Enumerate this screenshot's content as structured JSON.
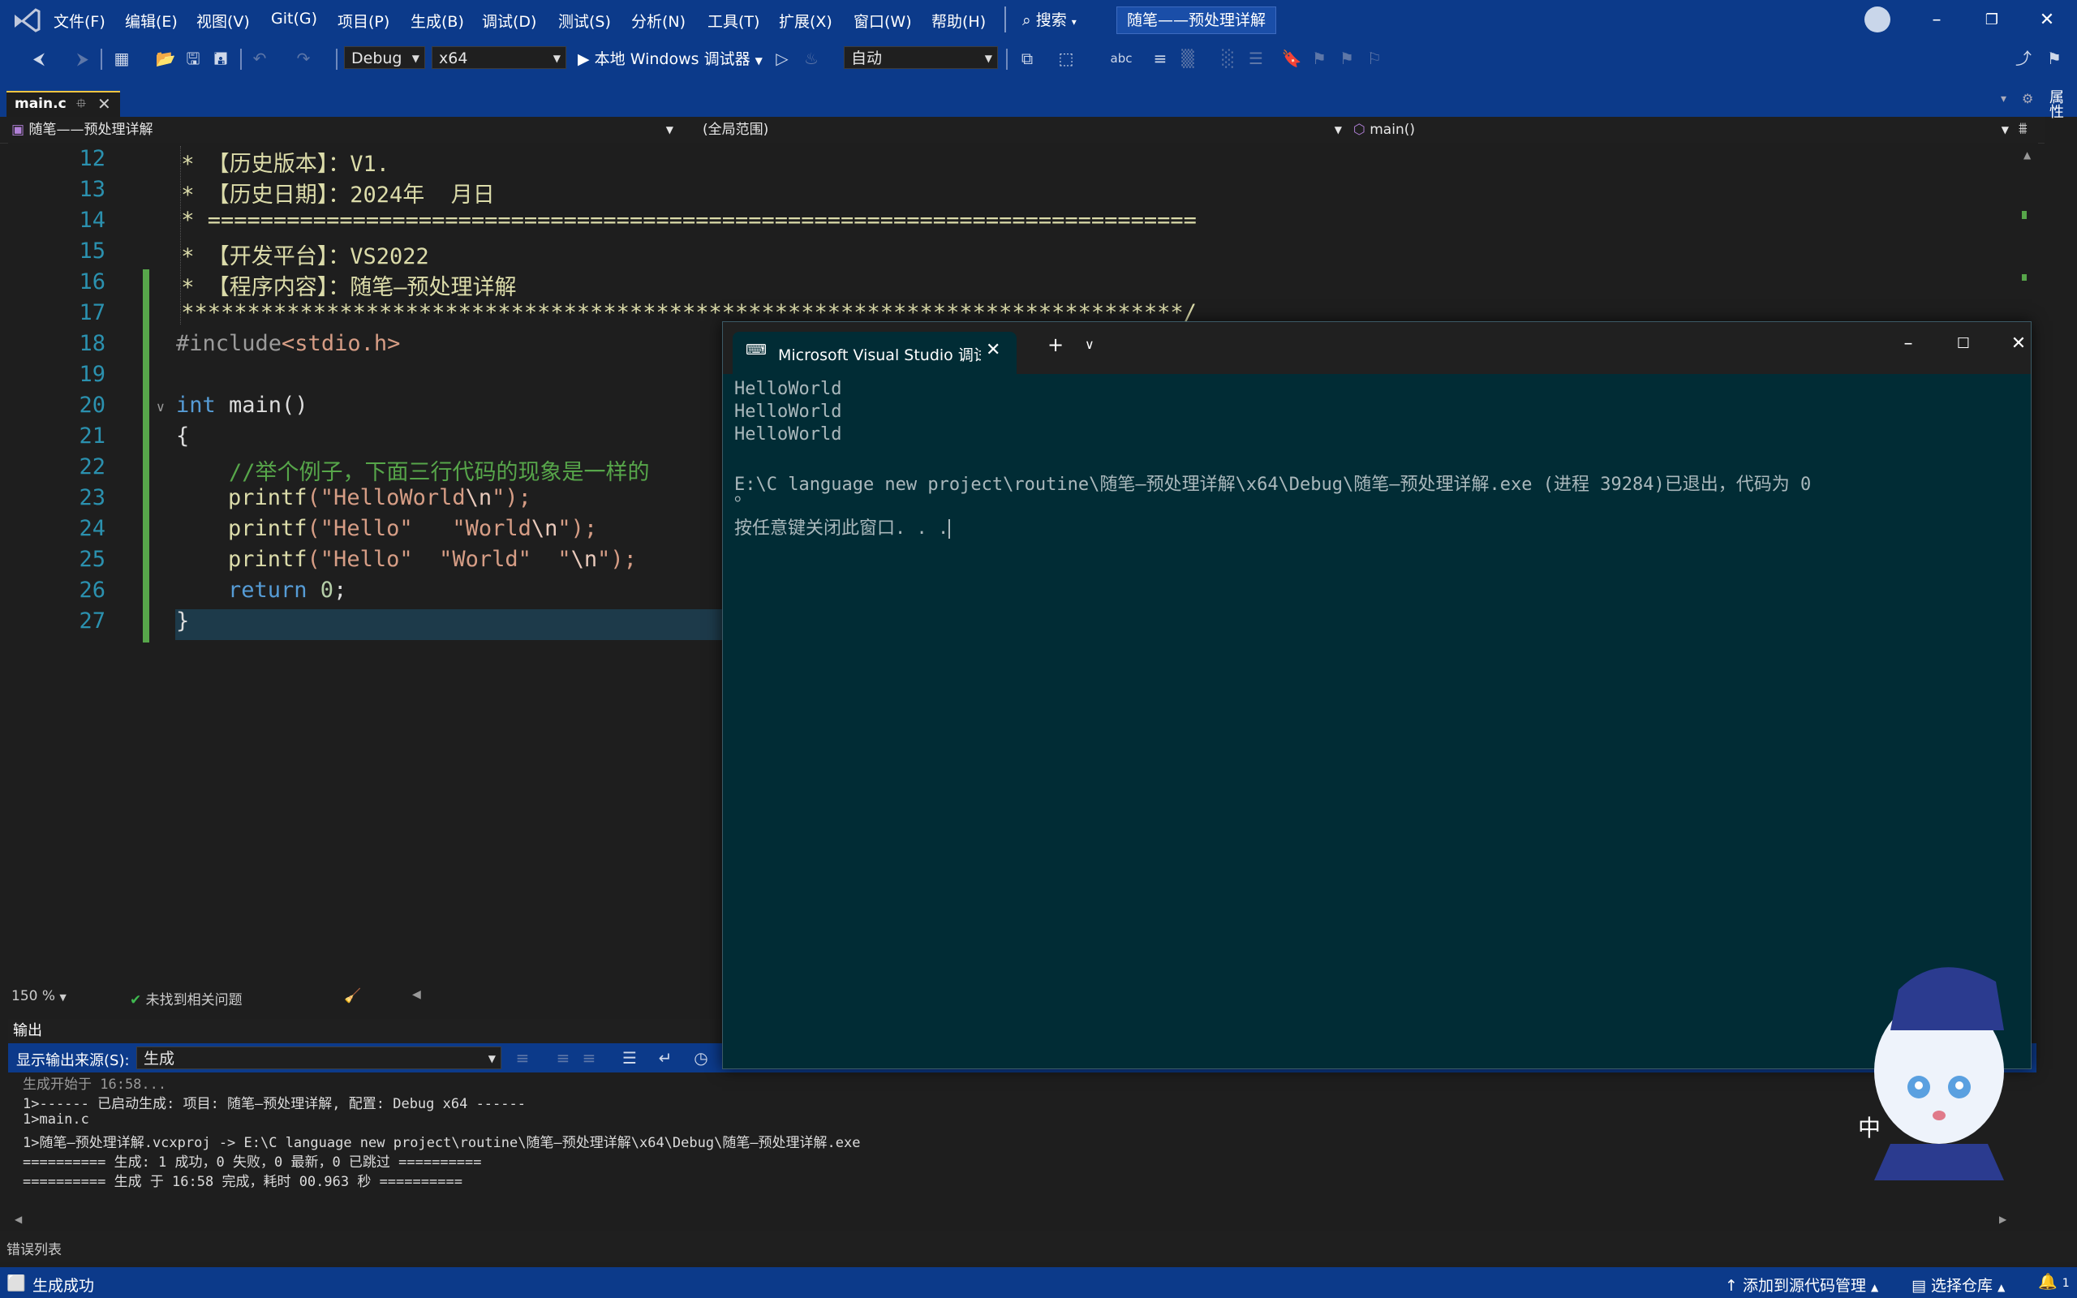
{
  "menubar": {
    "items": [
      "文件(F)",
      "编辑(E)",
      "视图(V)",
      "Git(G)",
      "项目(P)",
      "生成(B)",
      "调试(D)",
      "测试(S)",
      "分析(N)",
      "工具(T)",
      "扩展(X)",
      "窗口(W)",
      "帮助(H)"
    ],
    "search_label": "搜索",
    "solution_title": "随笔——预处理详解"
  },
  "toolbar": {
    "config": "Debug",
    "platform": "x64",
    "run_label": "本地 Windows 调试器",
    "auto_label": "自动"
  },
  "tabs": {
    "active": "main.c"
  },
  "right_panel_label": "属性",
  "navbar": {
    "project": "随笔——预处理详解",
    "scope": "(全局范围)",
    "member": "main()"
  },
  "editor": {
    "line_numbers": [
      "12",
      "13",
      "14",
      "15",
      "16",
      "17",
      "18",
      "19",
      "20",
      "21",
      "22",
      "23",
      "24",
      "25",
      "26",
      "27"
    ],
    "code": {
      "l12": " * 【历史版本】：V1.",
      "l13": " * 【历史日期】：2024年  月日",
      "l14": " * ===========================================================================",
      "l15": " * 【开发平台】：VS2022",
      "l16": " * 【程序内容】：随笔—预处理详解",
      "l17": " ****************************************************************************/",
      "l18_a": "#include",
      "l18_b": "<stdio.h>",
      "l20_kw": "int",
      "l20_rest": " main()",
      "l21": "{",
      "l22": "    //举个例子，下面三行代码的现象是一样的",
      "l23_fn": "printf",
      "l23_s1": "(\"HelloWorld",
      "l23_esc": "\\n",
      "l23_end": "\");",
      "l24_fn": "printf",
      "l24_s1": "(\"Hello\"   \"World",
      "l24_esc": "\\n",
      "l24_end": "\");",
      "l25_fn": "printf",
      "l25_s1": "(\"Hello\"  \"World\"  \"",
      "l25_esc": "\\n",
      "l25_end": "\");",
      "l26_kw": "return",
      "l26_num": " 0",
      "l26_end": ";",
      "l27": "}"
    },
    "zoom": "150 %",
    "issues": "未找到相关问题"
  },
  "console": {
    "title": "Microsoft Visual Studio 调试控制台",
    "lines": [
      "HelloWorld",
      "HelloWorld",
      "HelloWorld",
      "",
      "E:\\C language new project\\routine\\随笔—预处理详解\\x64\\Debug\\随笔—预处理详解.exe (进程 39284)已退出，代码为 0",
      "。",
      "按任意键关闭此窗口. . ."
    ]
  },
  "output": {
    "title": "输出",
    "source_label": "显示输出来源(S):",
    "source_value": "生成",
    "lines": [
      "生成开始于 16:58...",
      "1>------ 已启动生成: 项目: 随笔—预处理详解, 配置: Debug x64 ------",
      "1>main.c",
      "1>随笔—预处理详解.vcxproj -> E:\\C language new project\\routine\\随笔—预处理详解\\x64\\Debug\\随笔—预处理详解.exe",
      "========== 生成: 1 成功，0 失败，0 最新，0 已跳过 ==========",
      "========== 生成 于 16:58 完成，耗时 00.963 秒 =========="
    ]
  },
  "errorlist_label": "错误列表",
  "statusbar": {
    "left": "生成成功",
    "source_control": "添加到源代码管理",
    "repo": "选择仓库",
    "notif_count": "1"
  },
  "colors": {
    "accent": "#0c3a8a",
    "console_bg": "#012c35",
    "changebar": "#57a64a"
  }
}
